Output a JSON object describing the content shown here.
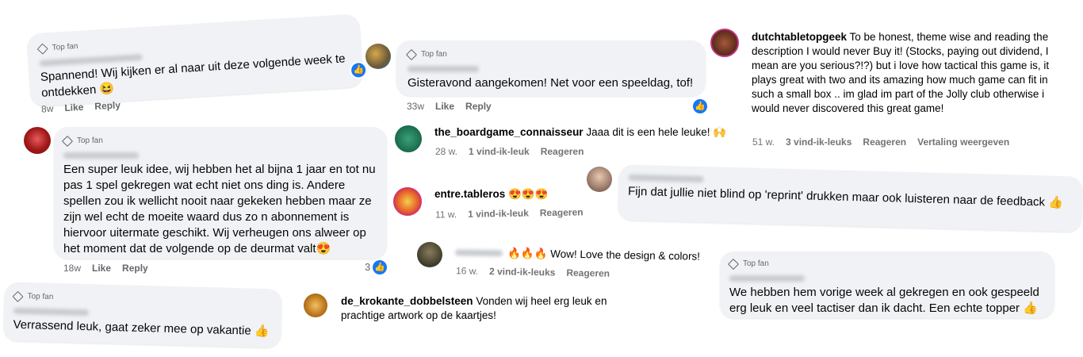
{
  "labels": {
    "top_fan": "Top fan",
    "like": "Like",
    "reply": "Reply",
    "respond": "Reageren"
  },
  "fb1": {
    "text": "Spannend! Wij kijken er al naar uit deze volgende week te ontdekken 😆",
    "time": "8w"
  },
  "fb2": {
    "text": "Gisteravond aangekomen! Net voor een speeldag, tof!",
    "time": "33w"
  },
  "fb3": {
    "text": "Een super leuk idee, wij hebben het al bijna 1 jaar en tot nu pas 1 spel gekregen wat echt niet ons ding is. Andere spellen zou ik wellicht nooit naar gekeken hebben maar ze zijn wel echt de moeite waard dus zo n abonnement is hiervoor uitermate geschikt. Wij verheugen ons alweer op het moment dat de volgende op de deurmat valt😍",
    "time": "18w",
    "likes": "3"
  },
  "fb4": {
    "text": "Verrassend leuk, gaat zeker mee op vakantie 👍"
  },
  "fb5": {
    "text": "Fijn dat jullie niet blind op 'reprint' drukken maar ook luisteren naar de feedback 👍"
  },
  "fb6": {
    "text": "We hebben hem vorige week al gekregen en ook gespeeld erg leuk en veel tactiser dan ik dacht. Een echte topper 👍"
  },
  "ig1": {
    "user": "dutchtabletopgeek",
    "text": "To be honest, theme wise and reading the description I would never Buy it! (Stocks, paying out dividend, I mean are you serious?!?) but i love how tactical this game is, it plays great with two and its amazing how much game can fit in such a small box .. im glad im part of the Jolly club otherwise i would never discovered this great game!",
    "time": "51 w.",
    "likes": "3 vind-ik-leuks",
    "translate": "Vertaling weergeven"
  },
  "ig2": {
    "user": "the_boardgame_connaisseur",
    "text": "Jaaa dit is een hele leuke! 🙌",
    "time": "28 w.",
    "likes": "1 vind-ik-leuk"
  },
  "ig3": {
    "user": "entre.tableros",
    "text": "😍😍😍",
    "time": "11 w.",
    "likes": "1 vind-ik-leuk"
  },
  "ig4": {
    "text": "🔥🔥🔥 Wow! Love the design & colors!",
    "time": "16 w.",
    "likes": "2 vind-ik-leuks"
  },
  "ig5": {
    "user": "de_krokante_dobbelsteen",
    "text": "Vonden wij heel erg leuk en prachtige artwork op de kaartjes!"
  },
  "colors": {
    "bubble": "#f0f2f5",
    "fb_blue": "#1877f2",
    "meta_grey": "#65676b"
  }
}
